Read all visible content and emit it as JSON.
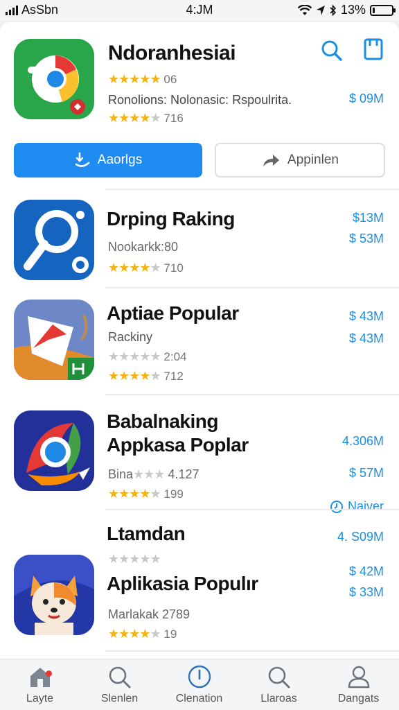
{
  "status_bar": {
    "carrier": "AsSbn",
    "time": "4:JM",
    "battery": "13%",
    "battery_level": 0.13
  },
  "featured": {
    "title": "Ndoranhesiai",
    "rating_count": "06",
    "subtitle": "Ronolions: Nolonasic: Rspoulrita.",
    "rating_count_2": "716",
    "price": "$ 09M",
    "primary_button": "Aaorlgs",
    "secondary_button": "Appinlen"
  },
  "apps": [
    {
      "name": "Drping Raking",
      "line1": "Nookarkk:80",
      "line2": "710",
      "price1": "$13M",
      "price2": "$ 53M"
    },
    {
      "name": "Aptiae Popular",
      "line1": "Rackiny",
      "line1b": "2:04",
      "line2": "712",
      "price1": "$ 43M",
      "price2": "$ 43M"
    },
    {
      "name": "Babalnaking",
      "name2": "Appkasa Poplar",
      "line1": "4.127",
      "line1_prefix": "Bina",
      "line2": "199",
      "price1": "4.306M",
      "price2": "$ 57M",
      "action": "Naiver"
    },
    {
      "name": "Ltamdan",
      "name2": "Aplikasia Populır",
      "line1": "Marlakak 2789",
      "line2": "19",
      "price1": "4. S09M",
      "price2": "$ 42M",
      "price3": "$ 33M"
    }
  ],
  "tab_bar": {
    "tabs": [
      {
        "label": "Layte",
        "icon": "home-icon"
      },
      {
        "label": "Slenlen",
        "icon": "search-icon"
      },
      {
        "label": "Clenation",
        "icon": "download-icon"
      },
      {
        "label": "Llaroas",
        "icon": "search-icon"
      },
      {
        "label": "Dangats",
        "icon": "person-icon"
      }
    ]
  },
  "colors": {
    "accent": "#1e8cf0",
    "price": "#1a8fe0",
    "stars": "#f3b316"
  }
}
